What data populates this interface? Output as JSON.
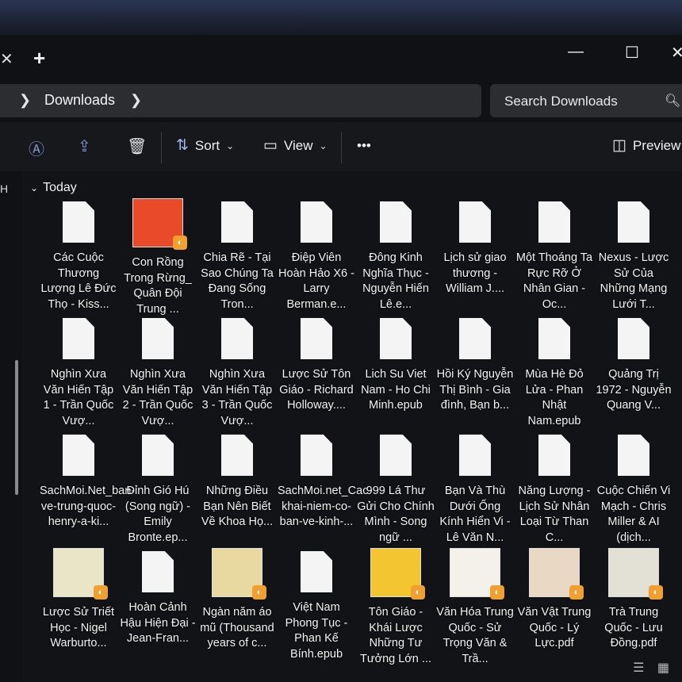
{
  "window": {
    "new_tab_label": "+",
    "controls": {
      "minimize": "—",
      "maximize": "☐",
      "close": "✕"
    }
  },
  "breadcrumb": {
    "current": "Downloads"
  },
  "search": {
    "placeholder": "Search Downloads"
  },
  "toolbar": {
    "sort_label": "Sort",
    "view_label": "View",
    "more_label": "•••",
    "preview_label": "Preview"
  },
  "sidebar": {
    "partial_label": "H"
  },
  "group": {
    "label": "Today"
  },
  "files": [
    {
      "name": "Các Cuộc Thương Lượng Lê Đức Thọ - Kiss...",
      "kind": "doc"
    },
    {
      "name": "Con Rồng Trong Rừng_ Quân Đội Trung ...",
      "kind": "cover",
      "cover_color": "#e84a2a"
    },
    {
      "name": "Chia Rẽ - Tại Sao Chúng Ta Đang Sống Tron...",
      "kind": "doc"
    },
    {
      "name": "Điệp Viên Hoàn Hảo X6 - Larry Berman.e...",
      "kind": "doc"
    },
    {
      "name": "Đông Kinh Nghĩa Thục - Nguyễn Hiến Lê.e...",
      "kind": "doc"
    },
    {
      "name": "Lịch sử giao thương - William J....",
      "kind": "doc"
    },
    {
      "name": "Một Thoáng Ta Rực Rỡ Ở Nhân Gian - Oc...",
      "kind": "doc"
    },
    {
      "name": "Nexus - Lược Sử Của Những Mạng Lưới T...",
      "kind": "doc"
    },
    {
      "name": "Nghìn Xưa Văn Hiến Tập 1 - Trần Quốc Vượ...",
      "kind": "doc"
    },
    {
      "name": "Nghìn Xưa Văn Hiến Tập 2 - Trần Quốc Vượ...",
      "kind": "doc"
    },
    {
      "name": "Nghìn Xưa Văn Hiến Tập 3 - Trần Quốc Vượ...",
      "kind": "doc"
    },
    {
      "name": "Lược Sử Tôn Giáo - Richard Holloway....",
      "kind": "doc"
    },
    {
      "name": "Lich Su Viet Nam - Ho Chi Minh.epub",
      "kind": "doc"
    },
    {
      "name": "Hồi Ký Nguyễn Thị Bình - Gia đình, Bạn b...",
      "kind": "doc"
    },
    {
      "name": "Mùa Hè Đỏ Lửa - Phan Nhật Nam.epub",
      "kind": "doc"
    },
    {
      "name": "Quảng Trị 1972 - Nguyễn Quang V...",
      "kind": "doc"
    },
    {
      "name": "SachMoi.Net_ban-ve-trung-quoc-henry-a-ki...",
      "kind": "doc"
    },
    {
      "name": "Đỉnh Gió Hú (Song ngữ) - Emily Bronte.ep...",
      "kind": "doc"
    },
    {
      "name": "Những Điều Bạn Nên Biết Về Khoa Họ...",
      "kind": "doc"
    },
    {
      "name": "SachMoi.net_Cac-khai-niem-co-ban-ve-kinh-...",
      "kind": "doc"
    },
    {
      "name": "999 Lá Thư Gửi Cho Chính Mình - Song ngữ ...",
      "kind": "doc"
    },
    {
      "name": "Bạn Và Thù Dưới Ống Kính Hiển Vi - Lê Văn N...",
      "kind": "doc"
    },
    {
      "name": "Năng Lượng - Lịch Sử Nhân Loại Từ Than C...",
      "kind": "doc"
    },
    {
      "name": "Cuộc Chiến Vi Mạch - Chris Miller & AI (dịch...",
      "kind": "doc"
    },
    {
      "name": "Lược Sử Triết Học - Nigel Warburto...",
      "kind": "cover",
      "cover_color": "#e9e6c8"
    },
    {
      "name": "Hoàn Cảnh Hậu Hiện Đại - Jean-Fran...",
      "kind": "doc"
    },
    {
      "name": "Ngàn năm áo mũ (Thousand years of c...",
      "kind": "cover",
      "cover_color": "#e8d9a0"
    },
    {
      "name": "Việt Nam Phong Tục - Phan Kế Bính.epub",
      "kind": "doc"
    },
    {
      "name": "Tôn Giáo - Khái Lược Những Tư Tưởng Lớn ...",
      "kind": "cover",
      "cover_color": "#f2c531"
    },
    {
      "name": "Văn Hóa Trung Quốc - Sử Trọng Văn & Trầ...",
      "kind": "cover",
      "cover_color": "#f3f1ea"
    },
    {
      "name": "Văn Vật Trung Quốc - Lý Lực.pdf",
      "kind": "cover",
      "cover_color": "#e9d8c4"
    },
    {
      "name": "Trà Trung Quốc - Lưu Đồng.pdf",
      "kind": "cover",
      "cover_color": "#e3e1d6"
    }
  ]
}
